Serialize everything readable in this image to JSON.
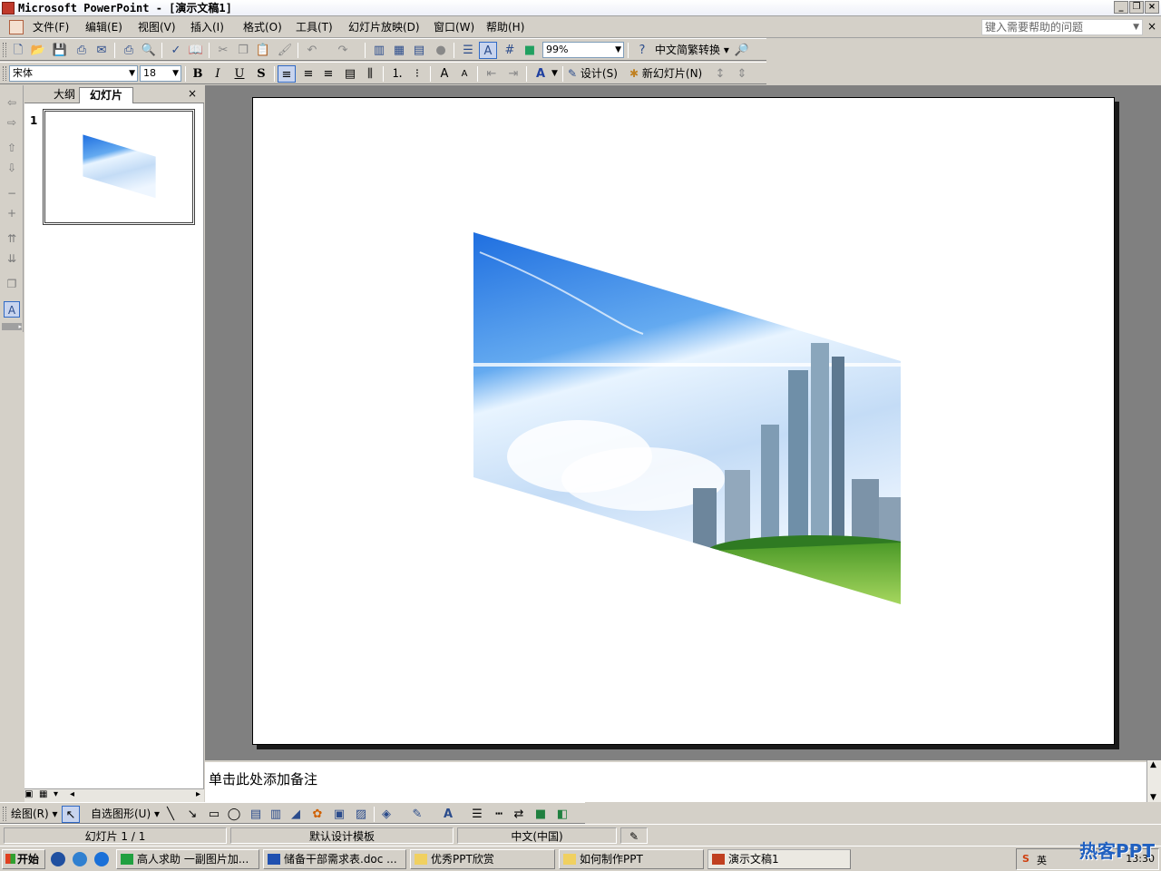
{
  "window": {
    "title": "Microsoft PowerPoint - [演示文稿1]"
  },
  "menu": {
    "items": [
      "文件(F)",
      "编辑(E)",
      "视图(V)",
      "插入(I)",
      "格式(O)",
      "工具(T)",
      "幻灯片放映(D)",
      "窗口(W)",
      "帮助(H)"
    ],
    "help_placeholder": "键入需要帮助的问题",
    "close": "×"
  },
  "standard_toolbar": {
    "zoom": "99%",
    "convert_label": "中文简繁转换"
  },
  "format_toolbar": {
    "font": "宋体",
    "font_size": "18",
    "bold": "B",
    "italic": "I",
    "underline": "U",
    "shadow": "S",
    "design_label": "设计(S)",
    "new_slide_label": "新幻灯片(N)"
  },
  "slides_pane": {
    "tab_outline": "大纲",
    "tab_slides": "幻灯片",
    "close": "×",
    "slide_number": "1"
  },
  "notes": {
    "placeholder": "单击此处添加备注"
  },
  "draw_toolbar": {
    "draw_label": "绘图(R)",
    "autoshape_label": "自选图形(U)"
  },
  "status": {
    "slide": "幻灯片 1 / 1",
    "template": "默认设计模板",
    "language": "中文(中国)"
  },
  "taskbar": {
    "start": "开始",
    "tasks": [
      {
        "label": "高人求助 一副图片加..."
      },
      {
        "label": "储备干部需求表.doc ..."
      },
      {
        "label": "优秀PPT欣赏"
      },
      {
        "label": "如何制作PPT"
      },
      {
        "label": "演示文稿1"
      }
    ],
    "ime": "英",
    "time": "13:30",
    "watermark": "热客PPT"
  }
}
